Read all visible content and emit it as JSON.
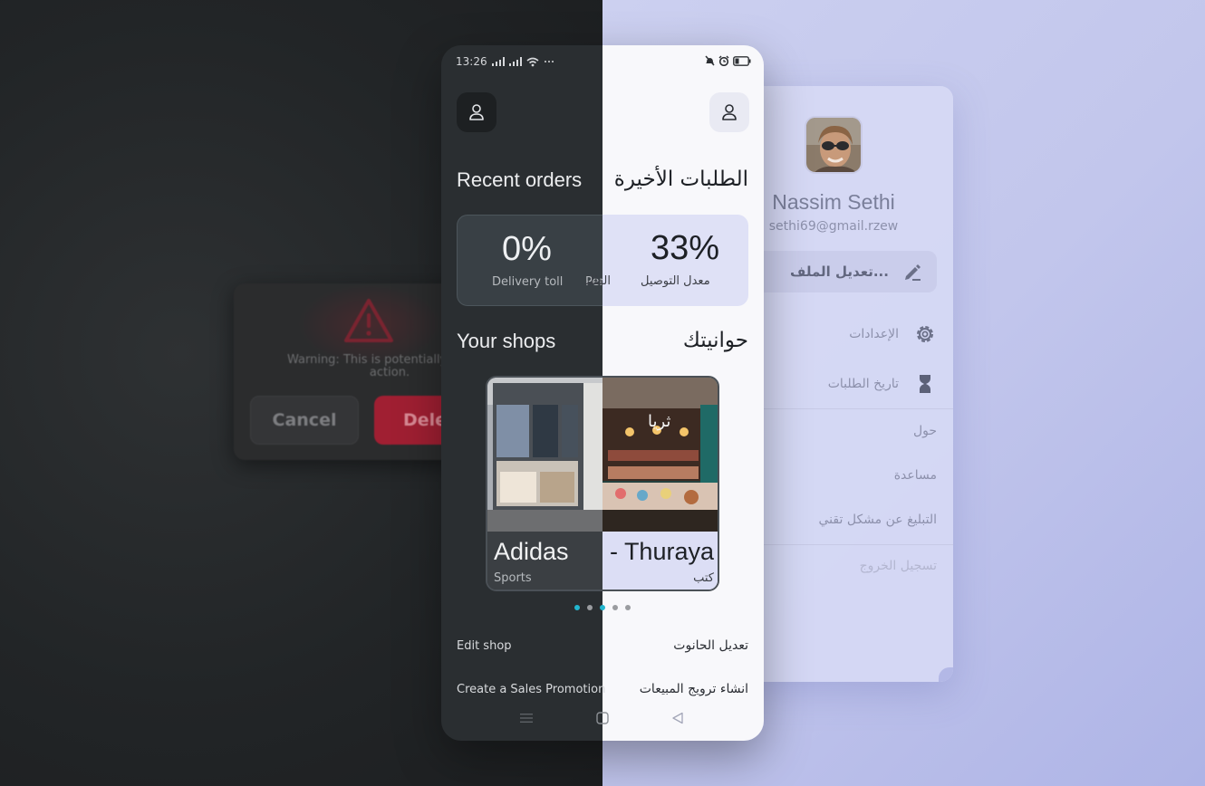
{
  "dialog": {
    "message": "Warning: This is potentially a destr\naction.",
    "cancel_label": "Cancel",
    "delete_label": "Delet"
  },
  "profile": {
    "name": "Nassim Sethi",
    "email": "sethi69@gmail.rzew",
    "edit_label": "تعديل الملف...",
    "menu": [
      {
        "label": "الإعدادات",
        "icon": "gear-icon"
      },
      {
        "label": "تاريخ الطلبات",
        "icon": "hourglass-icon"
      },
      {
        "label": "حول"
      },
      {
        "label": "مساعدة"
      },
      {
        "label": "التبليغ عن مشكل تقني"
      },
      {
        "label": "تسجيل الخروج"
      }
    ]
  },
  "status": {
    "time": "13:26"
  },
  "recent_orders": {
    "title_en": "Recent orders",
    "title_ar": "الطلبات الأخيرة"
  },
  "stats": {
    "left_value": "0%",
    "left_label": "Delivery toll",
    "left_label_cut": "Per",
    "right_value": "33%",
    "right_label": "معدل التوصيل",
    "right_label_cut": "الطلبا"
  },
  "shops": {
    "title_en": "Your shops",
    "title_ar": "حوانيتك",
    "card_left_name": "Adidas",
    "card_left_category": "Sports",
    "card_right_name": "- Thuraya",
    "card_right_category": "كتب",
    "sign_text": "ثريا",
    "pager": {
      "count": 5,
      "active": 3
    }
  },
  "actions": {
    "edit_en": "Edit shop",
    "edit_ar": "تعديل الحانوت",
    "promo_en": "Create a Sales Promotion",
    "promo_ar": "انشاء ترويج المبيعات"
  },
  "colors": {
    "accent": "#22b6cf",
    "danger": "#a01f32",
    "dark_bg": "#2a2e31",
    "light_bg": "#f8f8fb"
  }
}
